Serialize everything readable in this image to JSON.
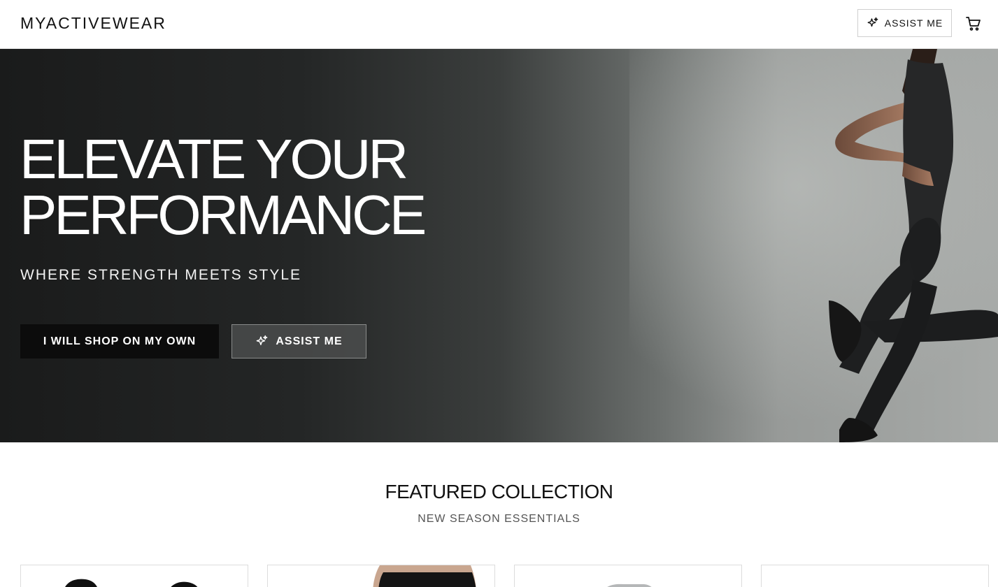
{
  "header": {
    "logo": "MYACTIVEWEAR",
    "assist_label": "ASSIST ME",
    "assist_icon": "sparkle-icon",
    "cart_icon": "cart-icon"
  },
  "hero": {
    "title_line1": "ELEVATE YOUR",
    "title_line2": "PERFORMANCE",
    "subtitle": "WHERE STRENGTH MEETS STYLE",
    "shop_own_label": "I WILL SHOP ON MY OWN",
    "assist_label": "ASSIST ME",
    "assist_icon": "sparkle-icon"
  },
  "featured": {
    "title": "FEATURED COLLECTION",
    "subtitle": "NEW SEASON ESSENTIALS"
  },
  "colors": {
    "text": "#111111",
    "button_dark": "#0c0c0c",
    "hero_dark": "#1a1b1b",
    "hero_light": "#a7aaa8"
  }
}
